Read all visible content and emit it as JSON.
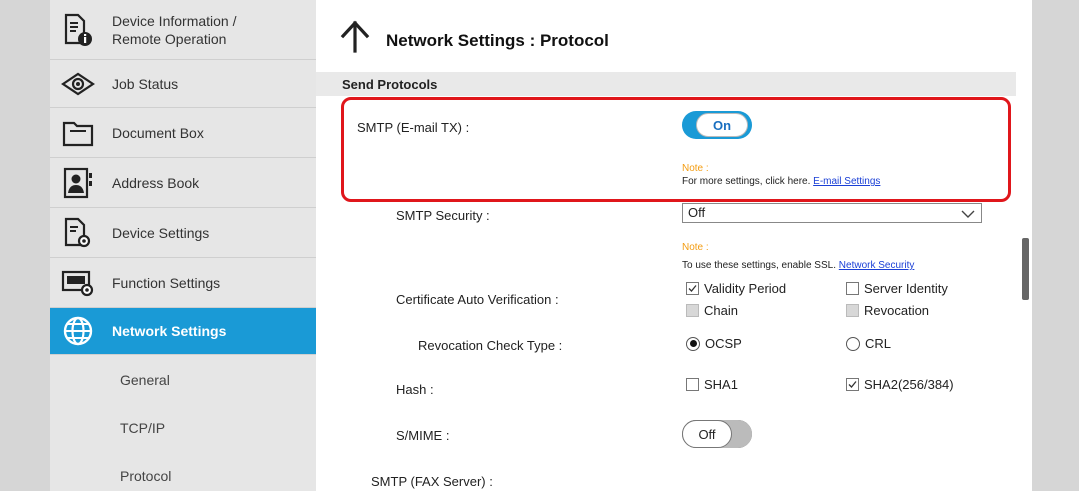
{
  "sidebar": {
    "items": [
      {
        "label": "Device Information /\nRemote Operation",
        "icon": "device-info-icon"
      },
      {
        "label": "Job Status",
        "icon": "job-status-icon"
      },
      {
        "label": "Document Box",
        "icon": "document-box-icon"
      },
      {
        "label": "Address Book",
        "icon": "address-book-icon"
      },
      {
        "label": "Device Settings",
        "icon": "device-settings-icon"
      },
      {
        "label": "Function Settings",
        "icon": "function-settings-icon"
      },
      {
        "label": "Network Settings",
        "icon": "network-globe-icon"
      }
    ],
    "sub_items": [
      {
        "label": "General"
      },
      {
        "label": "TCP/IP"
      },
      {
        "label": "Protocol"
      }
    ],
    "active_color": "#1a9ad6"
  },
  "header": {
    "title": "Network Settings : Protocol"
  },
  "section": {
    "title": "Send Protocols"
  },
  "settings": {
    "smtp_label": "SMTP (E-mail TX) :",
    "smtp_toggle": "On",
    "note1_head": "Note :",
    "note1_text": "For more settings, click here. ",
    "note1_link": "E-mail Settings",
    "smtp_security_label": "SMTP Security :",
    "smtp_security_value": "Off",
    "note2_head": "Note :",
    "note2_text": "To use these settings, enable SSL. ",
    "note2_link": "Network Security",
    "cert_label": "Certificate Auto Verification :",
    "cert_options": [
      {
        "label": "Validity Period",
        "checked": true,
        "disabled": false
      },
      {
        "label": "Server Identity",
        "checked": false,
        "disabled": false
      },
      {
        "label": "Chain",
        "checked": false,
        "disabled": true
      },
      {
        "label": "Revocation",
        "checked": false,
        "disabled": true
      }
    ],
    "revocation_label": "Revocation Check Type :",
    "revocation_options": [
      {
        "label": "OCSP",
        "selected": true
      },
      {
        "label": "CRL",
        "selected": false
      }
    ],
    "hash_label": "Hash :",
    "hash_options": [
      {
        "label": "SHA1",
        "checked": false
      },
      {
        "label": "SHA2(256/384)",
        "checked": true
      }
    ],
    "smime_label": "S/MIME :",
    "smime_toggle": "Off",
    "smtp_fax_label": "SMTP (FAX Server) :"
  },
  "colors": {
    "accent": "#1a9ad6",
    "highlight_border": "#e0161b",
    "note_orange": "#f39c12"
  }
}
